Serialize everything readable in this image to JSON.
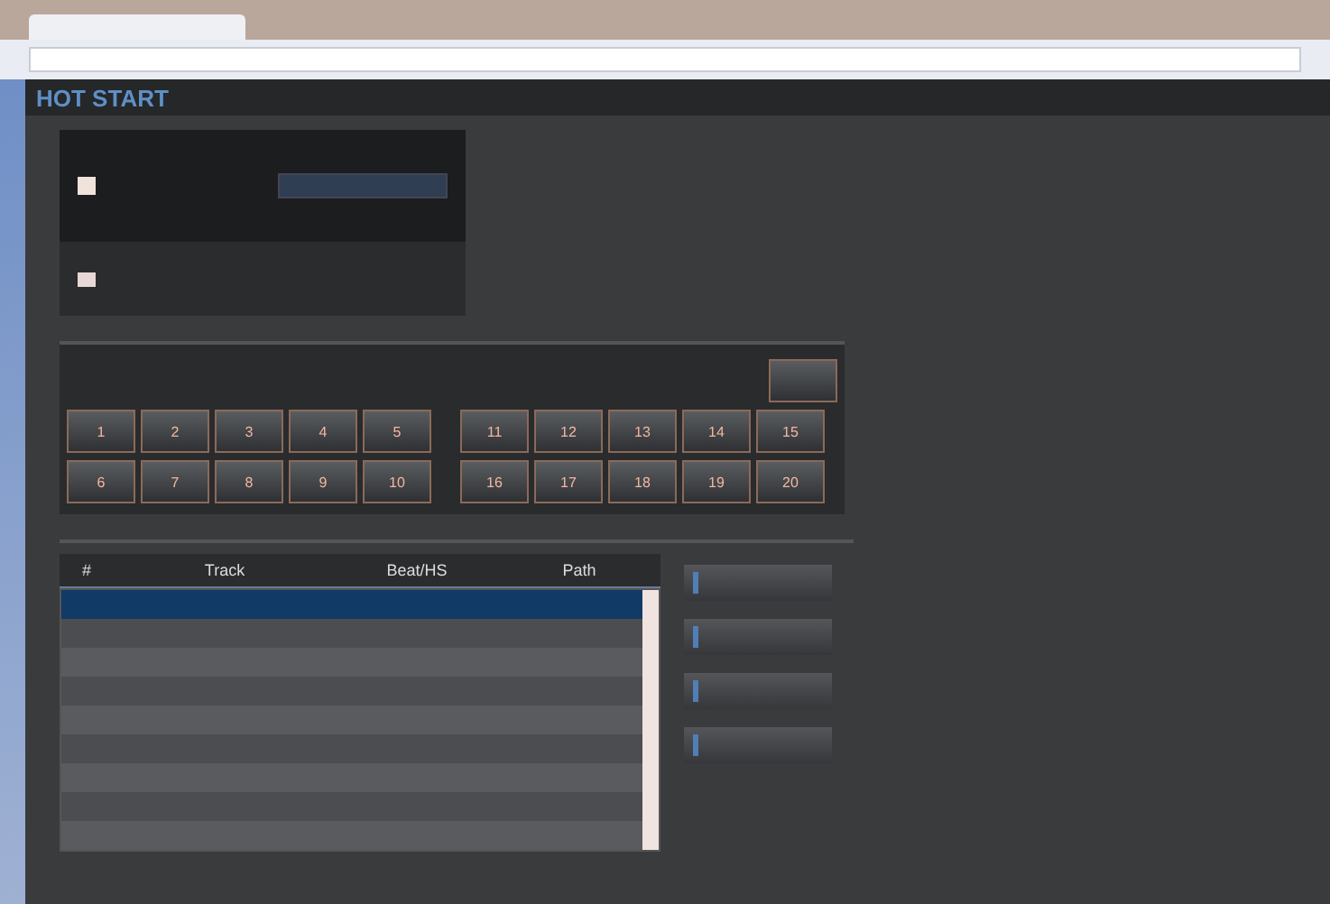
{
  "app": {
    "title": "HOT START"
  },
  "deck": {
    "checked": true
  },
  "pad_panel": {
    "pads": [
      {
        "label": "1"
      },
      {
        "label": "2"
      },
      {
        "label": "3"
      },
      {
        "label": "4"
      },
      {
        "label": "5"
      },
      {
        "label": "11"
      },
      {
        "label": "12"
      },
      {
        "label": "13"
      },
      {
        "label": "14"
      },
      {
        "label": "15"
      },
      {
        "label": "6"
      },
      {
        "label": "7"
      },
      {
        "label": "8"
      },
      {
        "label": "9"
      },
      {
        "label": "10"
      },
      {
        "label": "16"
      },
      {
        "label": "17"
      },
      {
        "label": "18"
      },
      {
        "label": "19"
      },
      {
        "label": "20"
      }
    ]
  },
  "table": {
    "columns": [
      "#",
      "Track",
      "Beat/HS",
      "Path"
    ],
    "rows": [
      {
        "selected": true
      },
      {
        "selected": false
      },
      {
        "selected": false
      },
      {
        "selected": false
      },
      {
        "selected": false
      },
      {
        "selected": false
      },
      {
        "selected": false
      },
      {
        "selected": false
      },
      {
        "selected": false
      }
    ]
  },
  "side_buttons": [
    {
      "kind": "action"
    },
    {
      "kind": "action"
    },
    {
      "kind": "action"
    },
    {
      "kind": "action"
    }
  ]
}
